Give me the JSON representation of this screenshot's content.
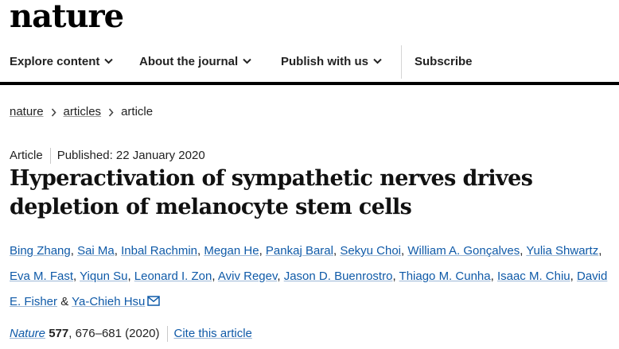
{
  "brand": {
    "logo_text": "nature"
  },
  "nav": {
    "items": [
      {
        "label": "Explore content",
        "has_dropdown": true
      },
      {
        "label": "About the journal",
        "has_dropdown": true
      },
      {
        "label": "Publish with us",
        "has_dropdown": true
      },
      {
        "label": "Subscribe",
        "has_dropdown": false
      }
    ]
  },
  "breadcrumb": [
    "nature",
    "articles",
    "article"
  ],
  "article": {
    "type": "Article",
    "published": "Published: 22 January 2020",
    "title": "Hyperactivation of sympathetic nerves drives depletion of melanocyte stem cells",
    "authors": [
      "Bing Zhang",
      "Sai Ma",
      "Inbal Rachmin",
      "Megan He",
      "Pankaj Baral",
      "Sekyu Choi",
      "William A. Gonçalves",
      "Yulia Shwartz",
      "Eva M. Fast",
      "Yiqun Su",
      "Leonard I. Zon",
      "Aviv Regev",
      "Jason D. Buenrostro",
      "Thiago M. Cunha",
      "Isaac M. Chiu",
      "David E. Fisher",
      "Ya-Chieh Hsu"
    ],
    "author_separator": ",",
    "author_and": "&",
    "corresponding_icon": "envelope-icon"
  },
  "citation": {
    "journal": "Nature",
    "volume": "577",
    "pages_year": ", 676–681 (2020)",
    "cite_label": "Cite this article"
  },
  "colors": {
    "link": "#0f5aa8",
    "text": "#222222",
    "nav_border": "#000000"
  }
}
